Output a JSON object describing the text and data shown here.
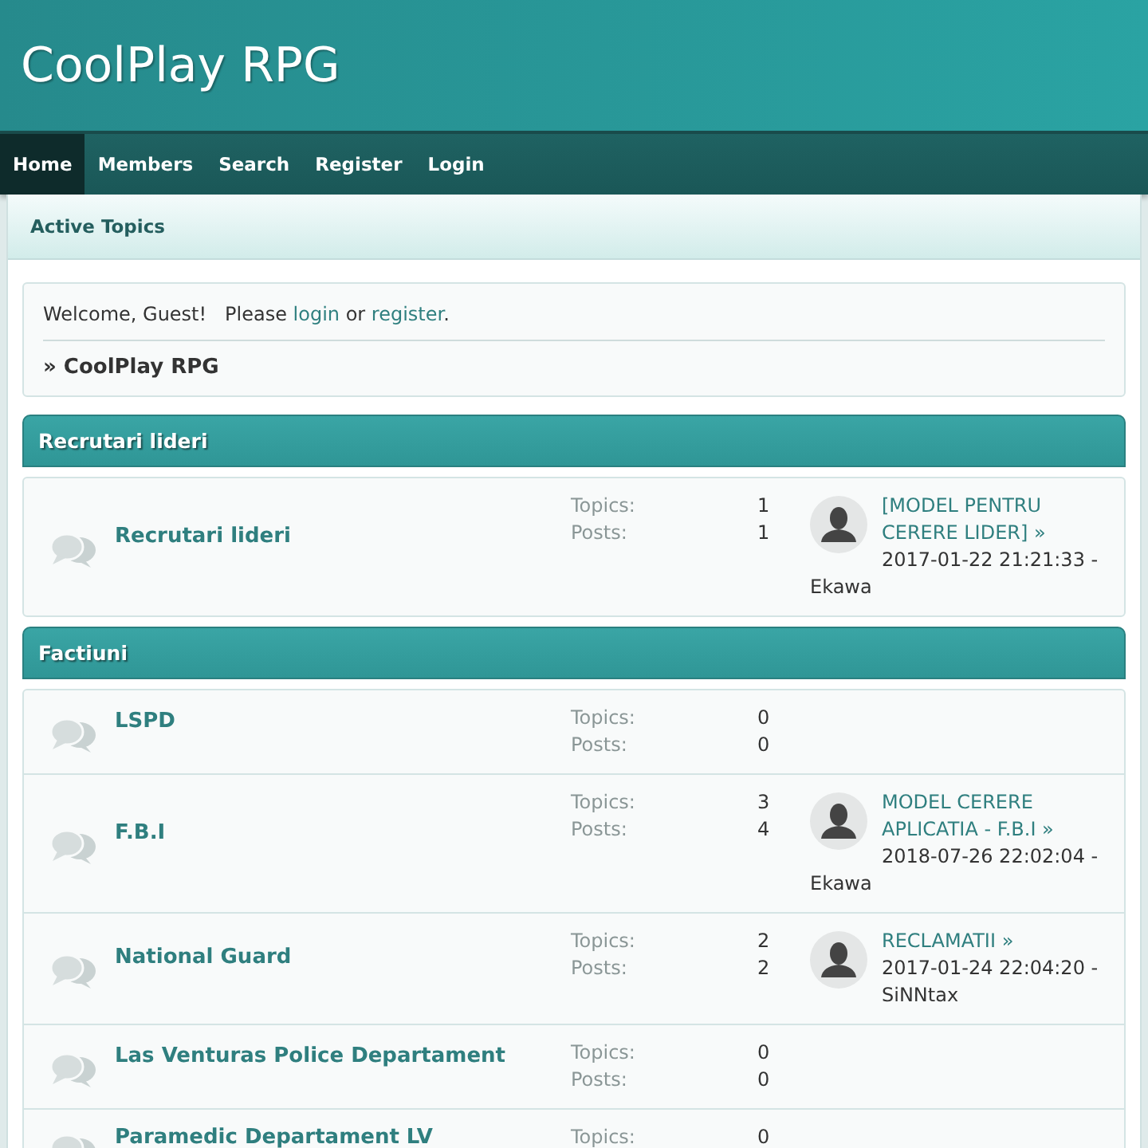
{
  "site_title": "CoolPlay RPG",
  "nav": [
    {
      "label": "Home",
      "selected": true
    },
    {
      "label": "Members",
      "selected": false
    },
    {
      "label": "Search",
      "selected": false
    },
    {
      "label": "Register",
      "selected": false
    },
    {
      "label": "Login",
      "selected": false
    }
  ],
  "subnav": {
    "label": "Active Topics"
  },
  "welcome": {
    "text_before": "Welcome, Guest!   Please",
    "login_link": "login",
    "text_middle": "or",
    "register_link": "register",
    "text_after": "."
  },
  "breadcrumb": "» CoolPlay RPG",
  "categories": [
    {
      "title": "Recrutari lideri",
      "boards": [
        {
          "name": "Recrutari lideri",
          "topics_label": "Topics:",
          "topics": "1",
          "posts_label": "Posts:",
          "posts": "1",
          "last_post": {
            "title": "[MODEL PENTRU CERERE LIDER] »",
            "date": "2017-01-22 21:21:33 -",
            "author": "Ekawa"
          }
        }
      ]
    },
    {
      "title": "Factiuni",
      "boards": [
        {
          "name": "LSPD",
          "topics_label": "Topics:",
          "topics": "0",
          "posts_label": "Posts:",
          "posts": "0"
        },
        {
          "name": "F.B.I",
          "topics_label": "Topics:",
          "topics": "3",
          "posts_label": "Posts:",
          "posts": "4",
          "last_post": {
            "title": "MODEL CERERE APLICATIA - F.B.I »",
            "date": "2018-07-26 22:02:04 -",
            "author": "Ekawa"
          }
        },
        {
          "name": "National Guard",
          "topics_label": "Topics:",
          "topics": "2",
          "posts_label": "Posts:",
          "posts": "2",
          "last_post": {
            "title": "RECLAMATII »",
            "date": "2017-01-24 22:04:20 -",
            "author": "SiNNtax"
          }
        },
        {
          "name": "Las Venturas Police Departament",
          "topics_label": "Topics:",
          "topics": "0",
          "posts_label": "Posts:",
          "posts": "0"
        },
        {
          "name": "Paramedic Departament LV",
          "topics_label": "Topics:",
          "topics": "0"
        }
      ]
    }
  ]
}
